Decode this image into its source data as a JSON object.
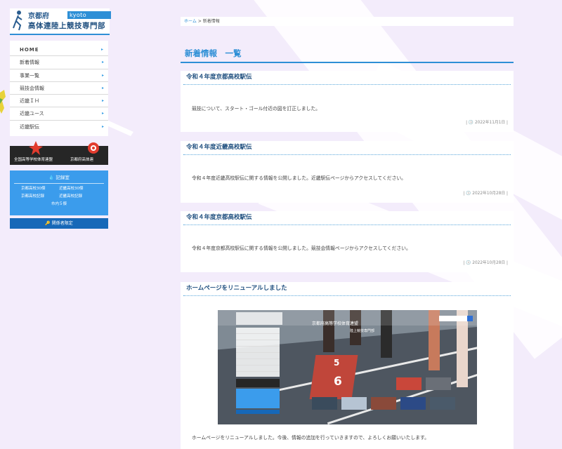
{
  "logo": {
    "prefecture": "京都府",
    "brand": "kyoto athletics",
    "org": "高体連陸上競技専門部"
  },
  "sidebar": {
    "items": [
      {
        "label": "HOME"
      },
      {
        "label": "新着情報"
      },
      {
        "label": "事業一覧"
      },
      {
        "label": "競技会情報"
      },
      {
        "label": "近畿ＩＨ"
      },
      {
        "label": "近畿ユース"
      },
      {
        "label": "近畿駅伝"
      }
    ],
    "chevron": "▸"
  },
  "banners": {
    "left_label": "全国高等学校体育連盟",
    "right_label": "京都府高体連"
  },
  "records": {
    "head": "記録室",
    "items": [
      "京都高校30傑",
      "近畿高校30傑",
      "京都高校記録",
      "近畿高校記録"
    ],
    "single": "市内５傑"
  },
  "members": {
    "label": "関係者限定"
  },
  "breadcrumb": {
    "home": "ホーム",
    "sep": ">",
    "current": "新着情報"
  },
  "page": {
    "title": "新着情報　一覧"
  },
  "posts": [
    {
      "title": "令和４年度京都高校駅伝",
      "body": "競技について、スタート・ゴール付近の図を訂正しました。",
      "date": "2022年11月1日"
    },
    {
      "title": "令和４年度近畿高校駅伝",
      "body": "令和４年度近畿高校駅伝に関する情報を公開しました。近畿駅伝ページからアクセスしてください。",
      "date": "2022年10月28日"
    },
    {
      "title": "令和４年度京都高校駅伝",
      "body": "令和４年度京都高校駅伝に関する情報を公開しました。競技会情報ページからアクセスしてください。",
      "date": "2022年10月28日"
    },
    {
      "title": "ホームページをリニューアルしました",
      "body": "ホームページをリニューアルしました。今後、情報の追加を行っていきますので、よろしくお願いいたします。"
    }
  ],
  "screenshot": {
    "title": "京都府高等学校体育連盟",
    "subtitle": "陸上競技専門部",
    "track_number_top": "5",
    "track_number_bottom": "6"
  },
  "colors": {
    "accent": "#2e8fd6",
    "navy": "#1768b8",
    "records_bg": "#3b9cec",
    "page_bg": "#f3ecfb"
  },
  "icons": {
    "date": "clock-icon",
    "records": "drop-icon",
    "members": "key-icon"
  }
}
